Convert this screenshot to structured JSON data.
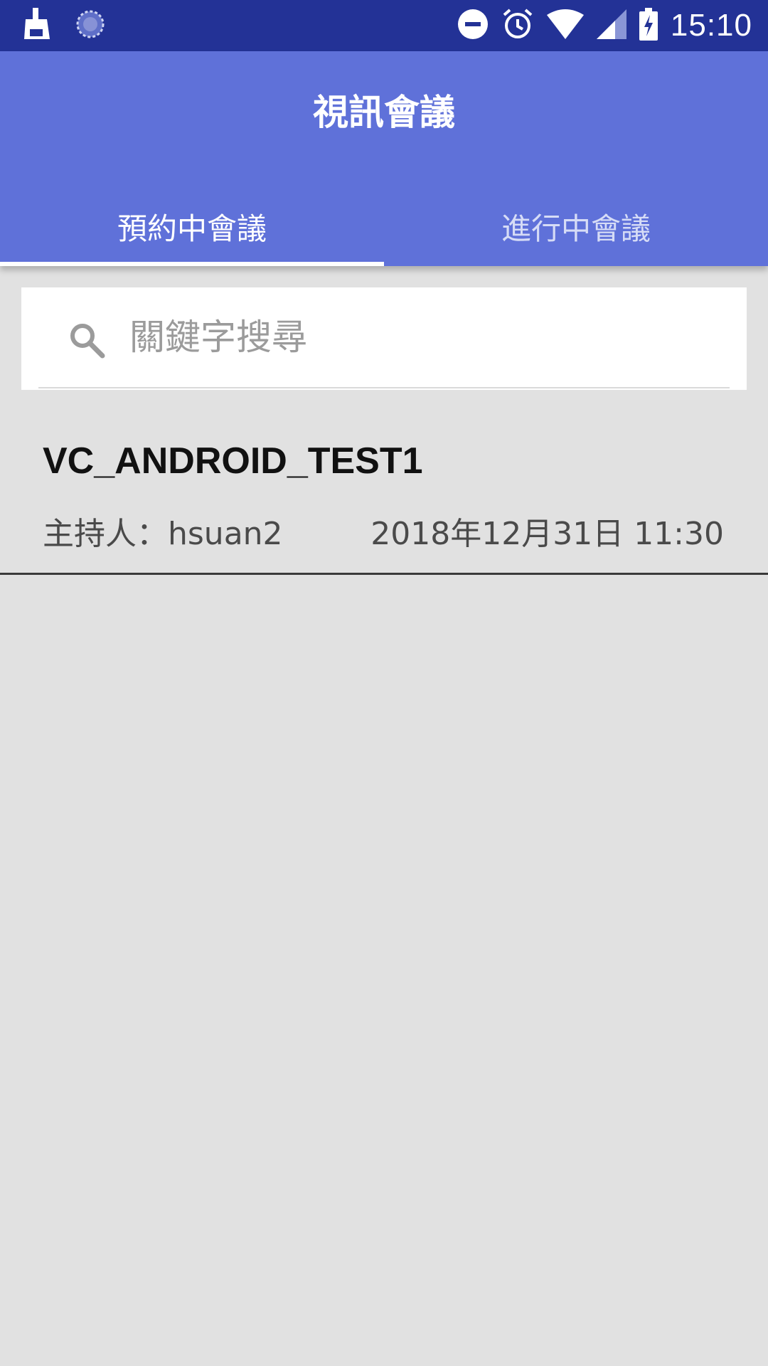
{
  "status_bar": {
    "time": "15:10",
    "icons": [
      "cleaner-icon",
      "loading-icon",
      "do-not-disturb-icon",
      "alarm-icon",
      "wifi-icon",
      "signal-icon",
      "battery-charging-icon"
    ]
  },
  "app_bar": {
    "title": "視訊會議",
    "background_color": "#5f71d9"
  },
  "tabs": [
    {
      "label": "預約中會議",
      "active": true
    },
    {
      "label": "進行中會議",
      "active": false
    }
  ],
  "search": {
    "placeholder": "關鍵字搜尋",
    "value": ""
  },
  "meetings": [
    {
      "name": "VC_ANDROID_TEST1",
      "host": "主持人：hsuan2",
      "datetime": "2018年12月31日 11:30"
    }
  ]
}
